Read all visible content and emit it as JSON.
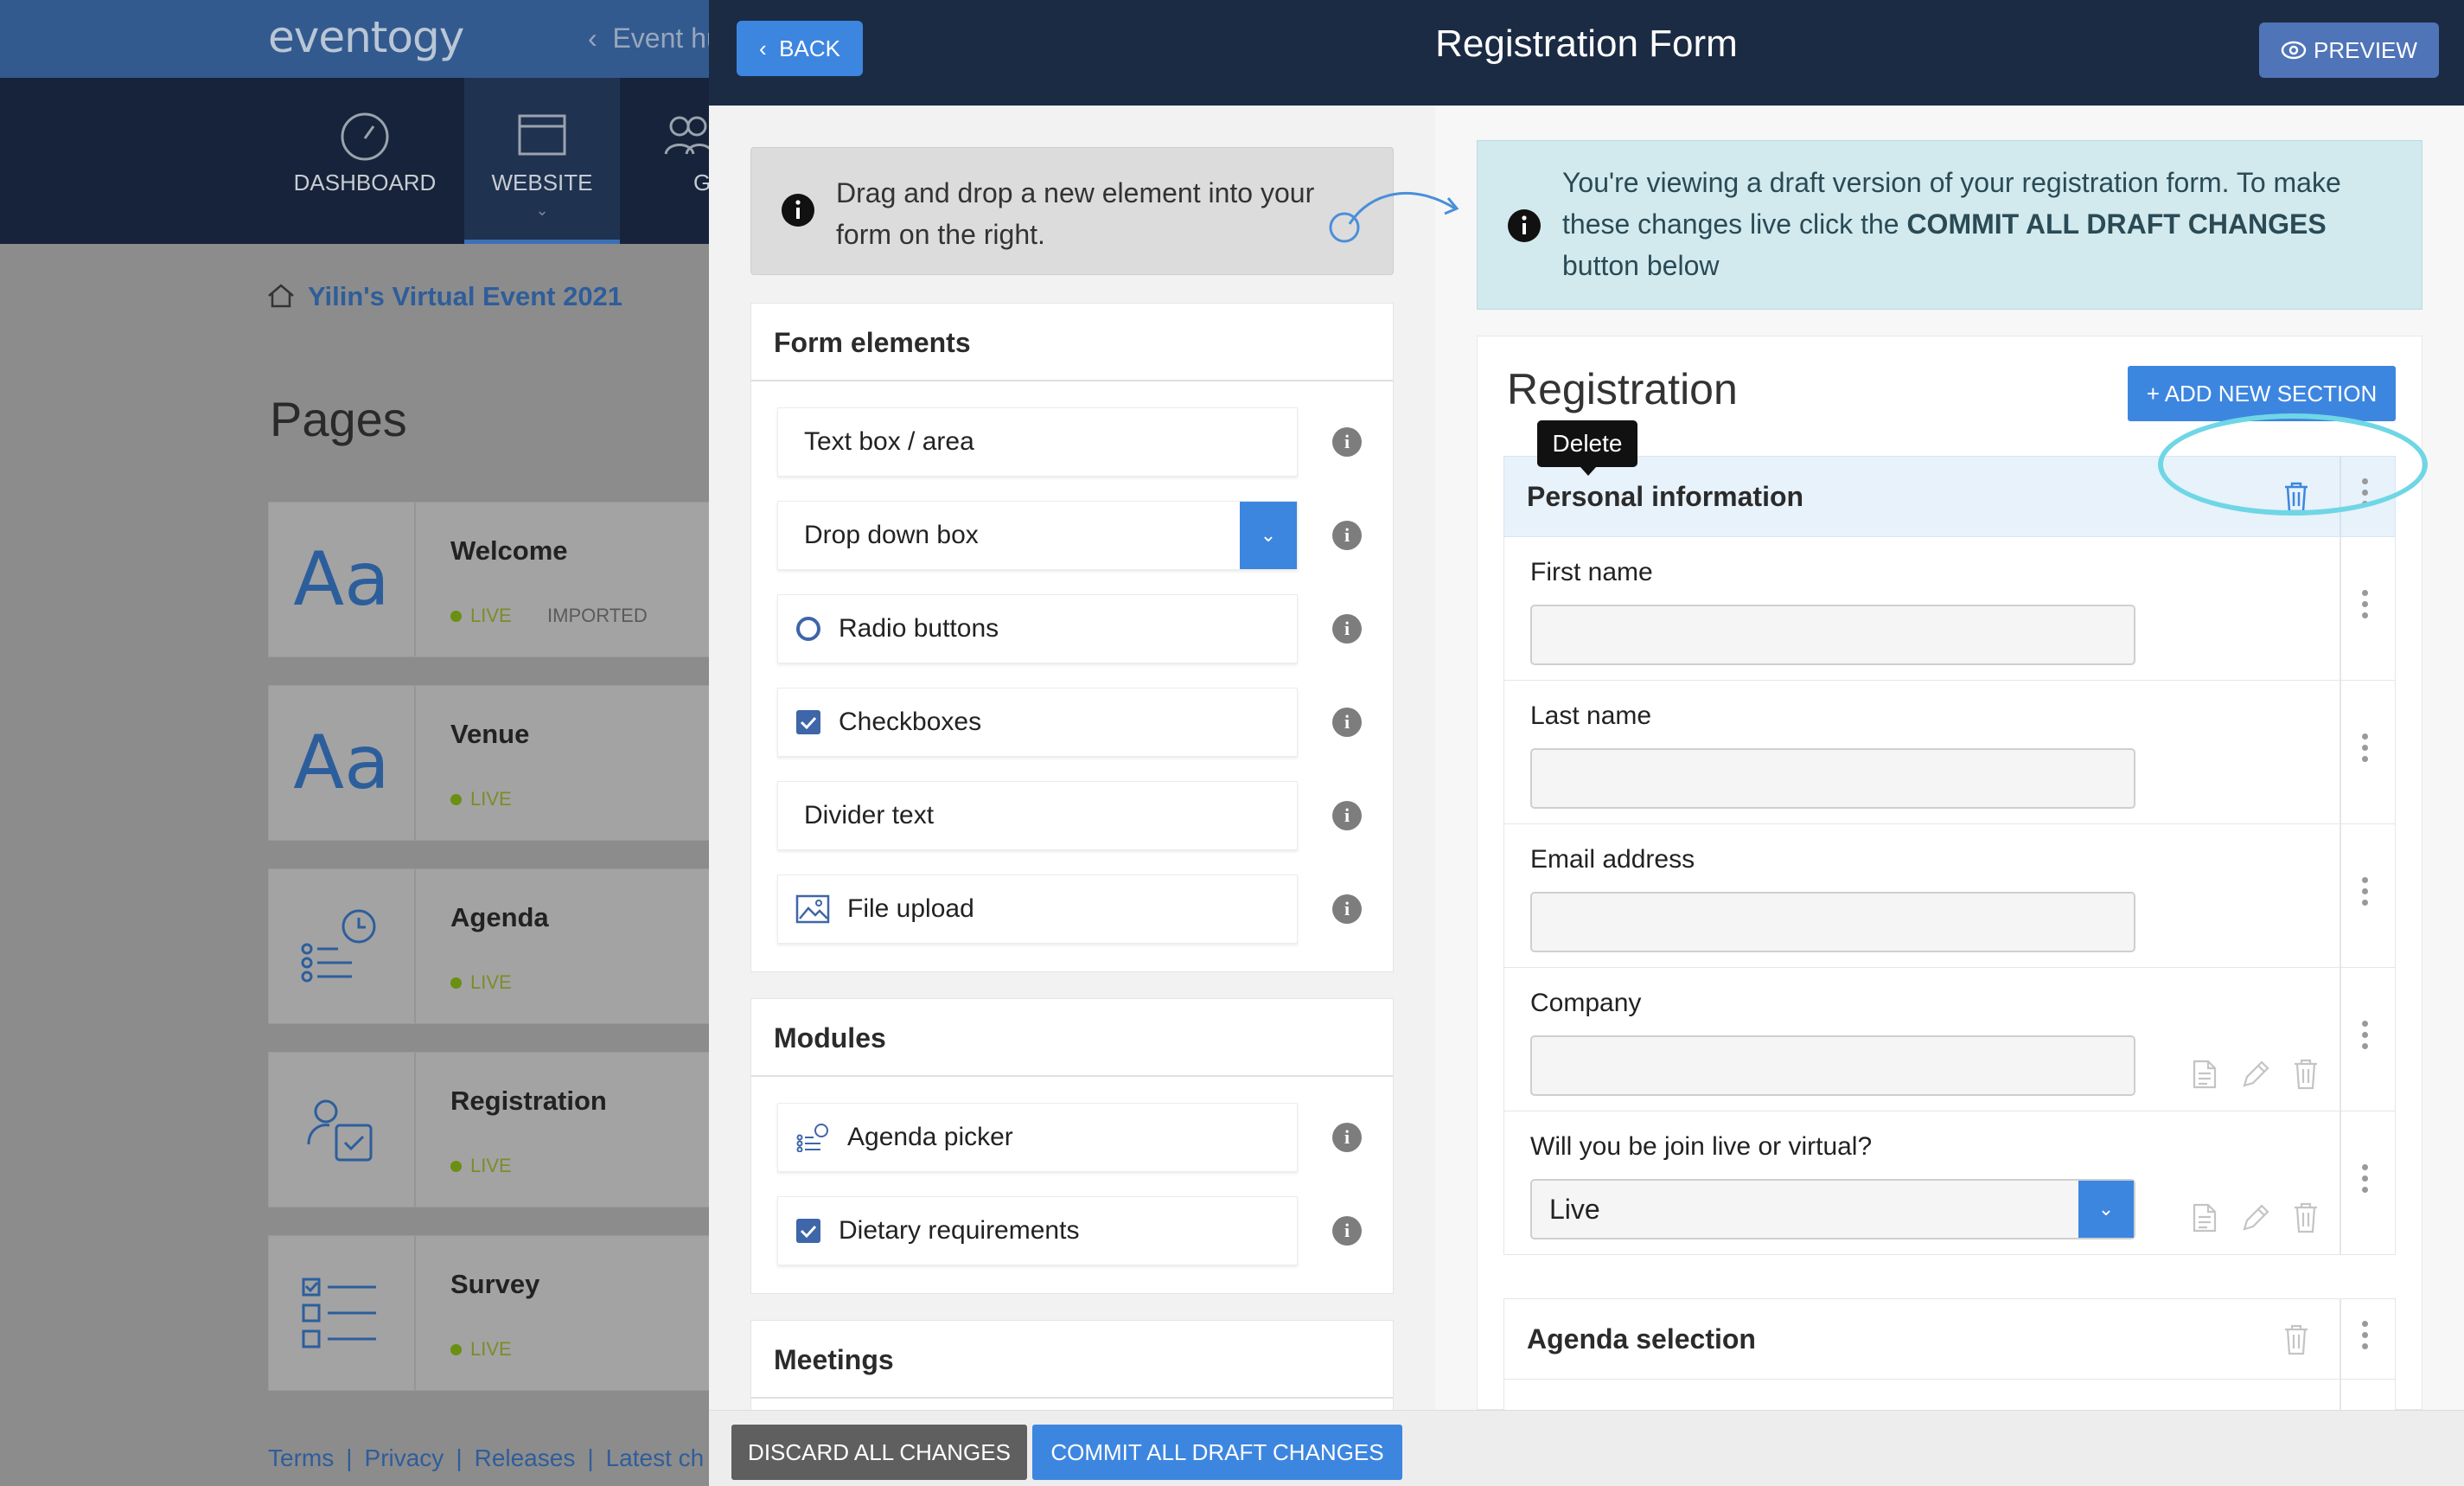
{
  "app": {
    "logo": "eventogy",
    "back_link": "Event hub",
    "nav": [
      {
        "label": "DASHBOARD",
        "icon": "gauge-icon"
      },
      {
        "label": "WEBSITE",
        "icon": "browser-window-icon",
        "active": true
      },
      {
        "label": "GUESTS",
        "icon": "guests-icon"
      }
    ],
    "breadcrumb": "Yilin's Virtual Event 2021",
    "pages_heading": "Pages",
    "pages": [
      {
        "title": "Welcome",
        "status": "LIVE",
        "tag": "IMPORTED",
        "thumb": "Aa"
      },
      {
        "title": "Venue",
        "status": "LIVE",
        "thumb": "Aa"
      },
      {
        "title": "Agenda",
        "status": "LIVE",
        "thumb_icon": "agenda-icon"
      },
      {
        "title": "Registration",
        "status": "LIVE",
        "thumb_icon": "registration-icon"
      },
      {
        "title": "Survey",
        "status": "LIVE",
        "thumb_icon": "survey-icon"
      }
    ],
    "footer": [
      "Terms",
      "|",
      "Privacy",
      "|",
      "Releases",
      "|",
      "Latest ch"
    ]
  },
  "modal": {
    "back_label": "BACK",
    "title": "Registration Form",
    "preview_label": "PREVIEW",
    "tip": "Drag and drop a new element into your form on the right.",
    "form_elements_title": "Form elements",
    "form_elements": [
      "Text box / area",
      "Drop down box",
      "Radio buttons",
      "Checkboxes",
      "Divider text",
      "File upload"
    ],
    "modules_title": "Modules",
    "modules": [
      "Agenda picker",
      "Dietary requirements"
    ],
    "meetings_title": "Meetings",
    "draft_notice_pre": "You're viewing a draft version of your registration form. To make these changes live click the ",
    "draft_notice_bold": "COMMIT ALL DRAFT CHANGES",
    "draft_notice_post": " button below",
    "registration_title": "Registration",
    "add_section_label": "+ ADD NEW SECTION",
    "tooltip": "Delete",
    "section1_title": "Personal information",
    "fields": [
      {
        "label": "First name",
        "value": ""
      },
      {
        "label": "Last name",
        "value": ""
      },
      {
        "label": "Email address",
        "value": ""
      },
      {
        "label": "Company",
        "value": ""
      },
      {
        "label": "Will you be join live or virtual?",
        "value": "Live"
      }
    ],
    "section2_title": "Agenda selection",
    "discard_label": "DISCARD ALL CHANGES",
    "commit_label": "COMMIT ALL DRAFT CHANGES"
  },
  "colors": {
    "accent": "#3d86e0",
    "header": "#1c2b44",
    "highlight_ring": "#6fd6e6"
  }
}
